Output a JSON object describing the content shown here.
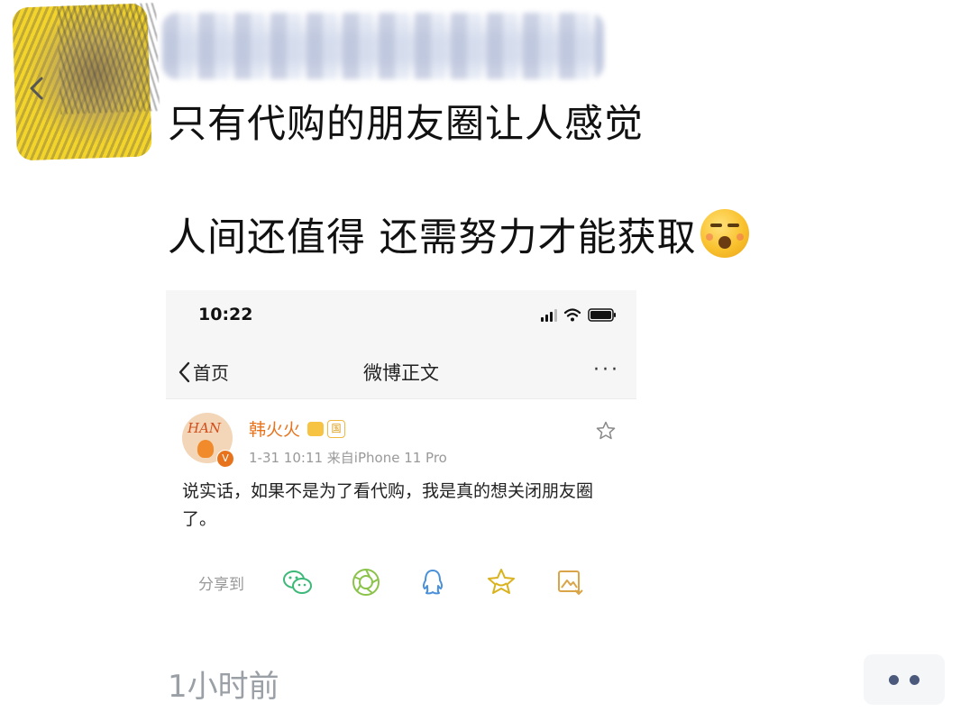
{
  "post": {
    "line1": "只有代购的朋友圈让人感觉",
    "line2": "人间还值得 还需努力才能获取",
    "timestamp": "1小时前"
  },
  "screenshot": {
    "status_time": "10:22",
    "nav": {
      "back_label": "首页",
      "title": "微博正文",
      "more": "···"
    },
    "author": {
      "name": "韩火火",
      "avatar_text": "HAN",
      "verified_mark": "V",
      "badge_text": "国",
      "meta": "1-31 10:11  来自iPhone 11 Pro"
    },
    "body": "说实话，如果不是为了看代购，我是真的想关闭朋友圈了。",
    "share": {
      "label": "分享到",
      "icons": [
        "wechat-icon",
        "moments-icon",
        "qq-icon",
        "favorite-star-icon",
        "save-image-icon"
      ]
    }
  },
  "colors": {
    "accent_orange": "#e8731d",
    "share_green": "#3cb878",
    "share_blue": "#4a90d9",
    "share_yellow": "#d9b21e",
    "timestamp_gray": "#9aa0a6",
    "more_dots": "#4b5a7c"
  }
}
